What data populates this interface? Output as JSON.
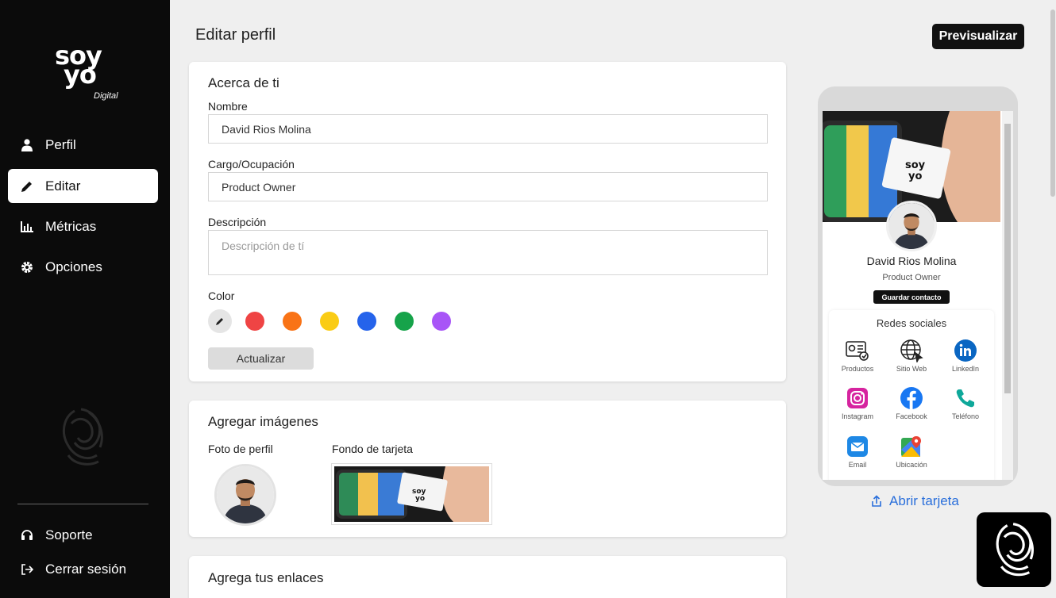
{
  "app": {
    "logo": {
      "line1": "soy",
      "line2": "yo",
      "line3": "Digital"
    }
  },
  "sidebar": {
    "items": [
      {
        "label": "Perfil",
        "icon": "user-icon"
      },
      {
        "label": "Editar",
        "icon": "pencil-icon",
        "active": true
      },
      {
        "label": "Métricas",
        "icon": "chart-icon"
      },
      {
        "label": "Opciones",
        "icon": "gear-icon"
      }
    ],
    "footer": [
      {
        "label": "Soporte",
        "icon": "headset-icon"
      },
      {
        "label": "Cerrar sesión",
        "icon": "logout-icon"
      }
    ]
  },
  "header": {
    "title": "Editar perfil",
    "preview_label": "Previsualizar"
  },
  "about": {
    "title": "Acerca de ti",
    "name_label": "Nombre",
    "name_value": "David Rios Molina",
    "role_label": "Cargo/Ocupación",
    "role_value": "Product Owner",
    "desc_label": "Descripción",
    "desc_placeholder": "Descripción de tí",
    "color_label": "Color",
    "colors": [
      "#ef4444",
      "#f97316",
      "#facc15",
      "#2563eb",
      "#16a34a",
      "#a855f7"
    ],
    "update_label": "Actualizar"
  },
  "images": {
    "title": "Agregar imágenes",
    "profile_label": "Foto de perfil",
    "background_label": "Fondo de tarjeta"
  },
  "links": {
    "title": "Agrega tus enlaces"
  },
  "preview": {
    "card_name": "David Rios Molina",
    "card_role": "Product Owner",
    "save_contact": "Guardar contacto",
    "social_title": "Redes sociales",
    "socials": [
      {
        "label": "Productos",
        "icon": "products-icon"
      },
      {
        "label": "Sitio Web",
        "icon": "globe-icon"
      },
      {
        "label": "LinkedIn",
        "icon": "linkedin-icon"
      },
      {
        "label": "Instagram",
        "icon": "instagram-icon"
      },
      {
        "label": "Facebook",
        "icon": "facebook-icon"
      },
      {
        "label": "Teléfono",
        "icon": "phone-icon"
      },
      {
        "label": "Email",
        "icon": "email-icon"
      },
      {
        "label": "Ubicación",
        "icon": "map-icon"
      }
    ],
    "open_label": "Abrir tarjeta"
  }
}
